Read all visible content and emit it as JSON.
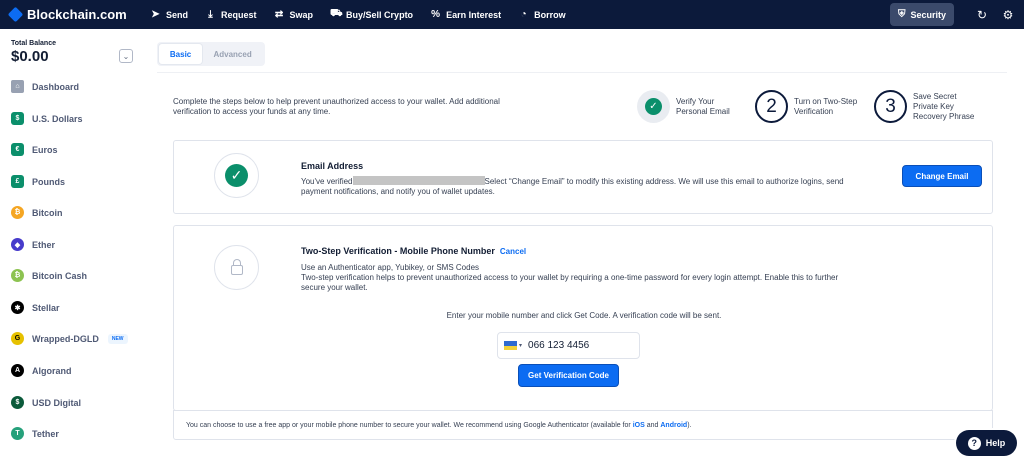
{
  "brand": {
    "name": "Blockchain.com"
  },
  "nav": {
    "items": [
      {
        "label": "Send",
        "icon": "paper-plane-icon",
        "glyph": "➤"
      },
      {
        "label": "Request",
        "icon": "download-icon",
        "glyph": "⤓"
      },
      {
        "label": "Swap",
        "icon": "swap-icon",
        "glyph": "⇄"
      },
      {
        "label": "Buy/Sell Crypto",
        "icon": "cart-icon",
        "glyph": "⛟"
      },
      {
        "label": "Earn Interest",
        "icon": "percent-icon",
        "glyph": "%"
      },
      {
        "label": "Borrow",
        "icon": "pie-icon",
        "glyph": "◔"
      }
    ],
    "security_label": "Security",
    "security_glyph": "⛨",
    "refresh_glyph": "↻",
    "settings_glyph": "⚙"
  },
  "sidebar": {
    "balance_label": "Total Balance",
    "balance_value": "$0.00",
    "toggle_glyph": "⌄",
    "items": [
      {
        "label": "Dashboard",
        "icon": "home-icon",
        "color": "#98a1b2",
        "glyph": "⌂"
      },
      {
        "label": "U.S. Dollars",
        "icon": "usd-icon",
        "color": "#0b8f6b",
        "glyph": "$"
      },
      {
        "label": "Euros",
        "icon": "eur-icon",
        "color": "#0b8f6b",
        "glyph": "€"
      },
      {
        "label": "Pounds",
        "icon": "gbp-icon",
        "color": "#0b8f6b",
        "glyph": "£"
      },
      {
        "label": "Bitcoin",
        "icon": "bitcoin-icon",
        "color": "#f5a623",
        "glyph": "₿"
      },
      {
        "label": "Ether",
        "icon": "ether-icon",
        "color": "#473bcb",
        "glyph": "◆"
      },
      {
        "label": "Bitcoin Cash",
        "icon": "bitcoin-cash-icon",
        "color": "#8dc351",
        "glyph": "₿"
      },
      {
        "label": "Stellar",
        "icon": "stellar-icon",
        "color": "#000000",
        "glyph": "✱"
      },
      {
        "label": "Wrapped-DGLD",
        "icon": "dgld-icon",
        "color": "#e6c100",
        "glyph": "G",
        "badge": "NEW"
      },
      {
        "label": "Algorand",
        "icon": "algorand-icon",
        "color": "#000000",
        "glyph": "A"
      },
      {
        "label": "USD Digital",
        "icon": "usd-digital-icon",
        "color": "#0b5a3a",
        "glyph": "$"
      },
      {
        "label": "Tether",
        "icon": "tether-icon",
        "color": "#26a17b",
        "glyph": "T"
      }
    ]
  },
  "tabs": {
    "basic": "Basic",
    "advanced": "Advanced"
  },
  "intro_text": "Complete the steps below to help prevent unauthorized access to your wallet. Add additional verification to access your funds at any time.",
  "steps": [
    {
      "number": "",
      "line1": "Verify Your",
      "line2": "Personal Email",
      "line3": ""
    },
    {
      "number": "2",
      "line1": "Turn on Two-Step",
      "line2": "Verification",
      "line3": ""
    },
    {
      "number": "3",
      "line1": "Save Secret",
      "line2": "Private Key",
      "line3": "Recovery Phrase"
    }
  ],
  "email_card": {
    "title": "Email Address",
    "desc_before": "You've verified",
    "desc_after": "Select “Change Email” to modify this existing address. We will use this email to authorize logins, send payment notifications, and notify you of wallet updates.",
    "button": "Change Email",
    "check_glyph": "✓"
  },
  "twostep_card": {
    "title": "Two-Step Verification - Mobile Phone Number",
    "cancel": "Cancel",
    "line1": "Use an Authenticator app, Yubikey, or SMS Codes",
    "line2": "Two-step verification helps to prevent unauthorized access to your wallet by requiring a one-time password for every login attempt. Enable this to further secure your wallet.",
    "instruction": "Enter your mobile number and click Get Code. A verification code will be sent.",
    "phone_value": "066 123 4456",
    "button": "Get Verification Code"
  },
  "footer": {
    "text": "You can choose to use a free app or your mobile phone number to secure your wallet. We recommend using Google Authenticator (available for",
    "ios": "iOS",
    "and": "and",
    "android": "Android",
    "end": ")."
  },
  "help": {
    "label": "Help",
    "glyph": "?"
  }
}
